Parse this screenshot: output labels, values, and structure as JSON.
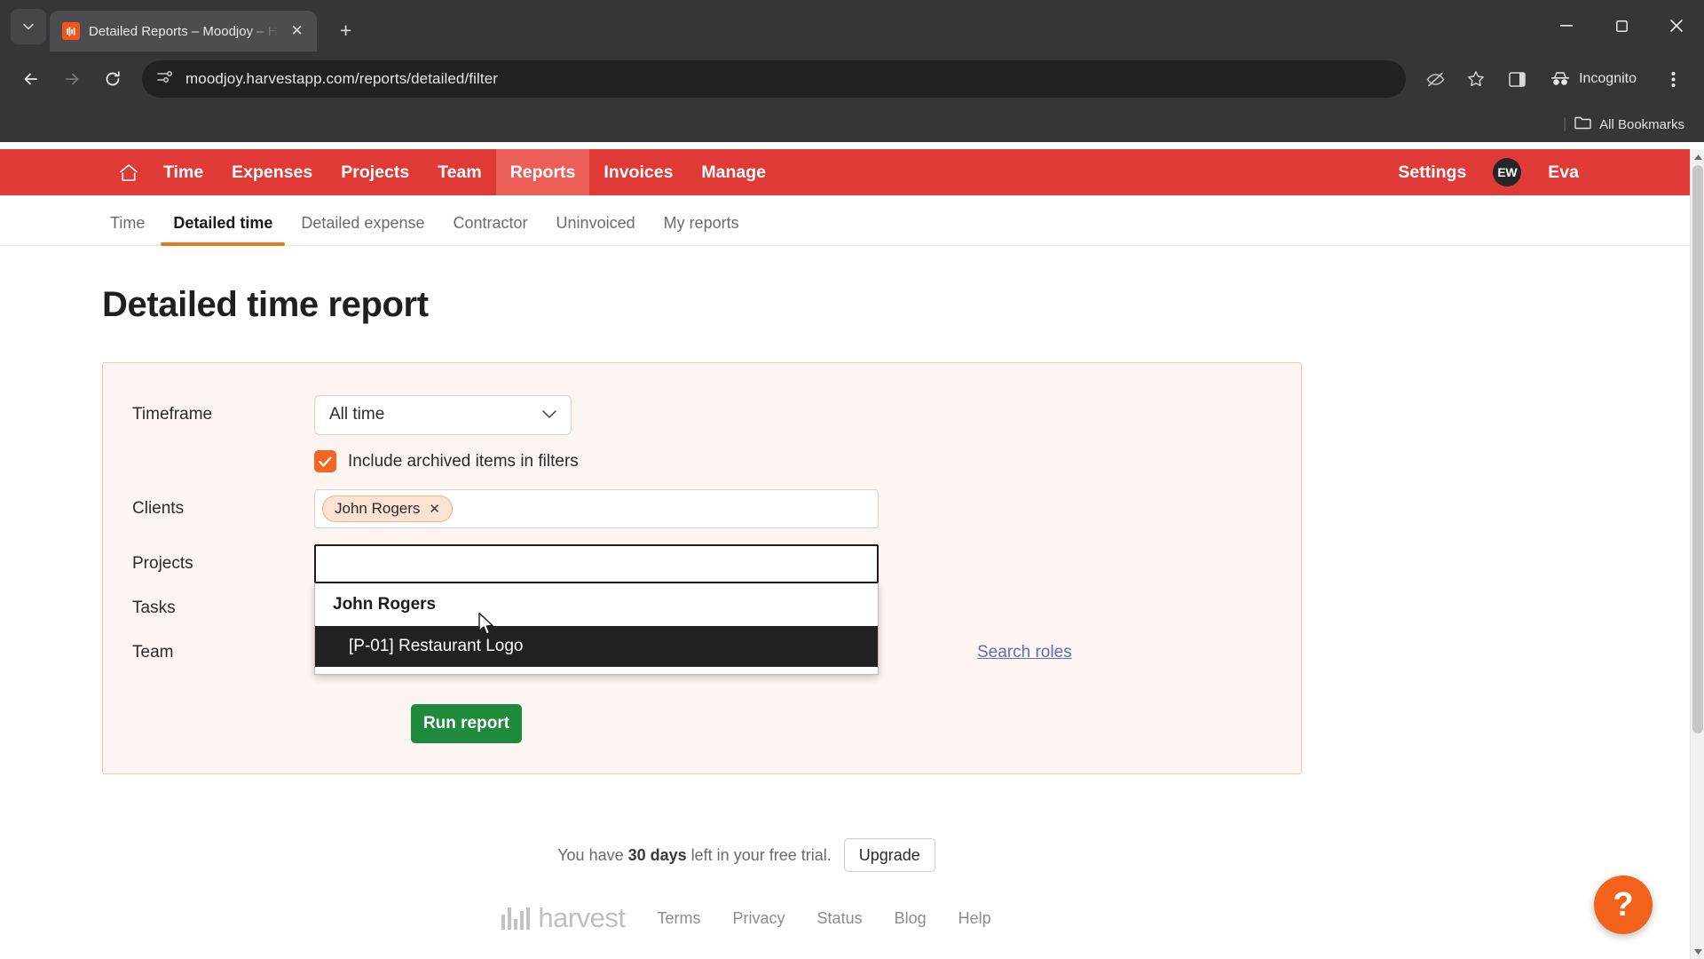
{
  "browser": {
    "tab": {
      "title": "Detailed Reports – Moodjoy – H",
      "favicon": "harvest-favicon",
      "close": "✕"
    },
    "new_tab": "+",
    "window_controls": {
      "minimize": "–",
      "maximize": "▢",
      "close": "✕"
    },
    "nav": {
      "back": "←",
      "forward": "→",
      "reload": "⟳"
    },
    "url": "moodjoy.harvestapp.com/reports/detailed/filter",
    "incognito_label": "Incognito",
    "bookmarks_label": "All Bookmarks"
  },
  "topnav": {
    "home_icon": "home-icon",
    "items": [
      {
        "label": "Time",
        "active": false
      },
      {
        "label": "Expenses",
        "active": false
      },
      {
        "label": "Projects",
        "active": false
      },
      {
        "label": "Team",
        "active": false
      },
      {
        "label": "Reports",
        "active": true
      },
      {
        "label": "Invoices",
        "active": false
      },
      {
        "label": "Manage",
        "active": false
      }
    ],
    "settings_label": "Settings",
    "avatar_initials": "EW",
    "user_name": "Eva",
    "background_color": "#e03a36",
    "active_background_color": "#ec5f59"
  },
  "subnav": {
    "tabs": [
      {
        "label": "Time",
        "active": false
      },
      {
        "label": "Detailed time",
        "active": true
      },
      {
        "label": "Detailed expense",
        "active": false
      },
      {
        "label": "Contractor",
        "active": false
      },
      {
        "label": "Uninvoiced",
        "active": false
      },
      {
        "label": "My reports",
        "active": false
      }
    ],
    "active_underline_color": "#e8761a"
  },
  "page": {
    "title": "Detailed time report"
  },
  "filters": {
    "timeframe": {
      "label": "Timeframe",
      "value": "All time",
      "chevron": "⌄"
    },
    "archived": {
      "label": "Include archived items in filters",
      "checked": true,
      "check_glyph": "✓",
      "color": "#f26522"
    },
    "clients": {
      "label": "Clients",
      "chips": [
        {
          "text": "John Rogers",
          "remove": "✕"
        }
      ]
    },
    "projects": {
      "label": "Projects",
      "value": "",
      "dropdown": {
        "group_header": "John Rogers",
        "options": [
          {
            "label": "[P-01] Restaurant Logo",
            "highlighted": true
          }
        ]
      }
    },
    "tasks": {
      "label": "Tasks"
    },
    "team": {
      "label": "Team",
      "search_roles_link": "Search roles"
    },
    "run_report_button": "Run report",
    "card_background": "#fdf5f1",
    "card_border": "#f3c7a8"
  },
  "trial": {
    "prefix": "You have ",
    "days": "30 days",
    "suffix": " left in your free trial.",
    "upgrade_button": "Upgrade"
  },
  "footer": {
    "logo_text": "harvest",
    "links": [
      "Terms",
      "Privacy",
      "Status",
      "Blog",
      "Help"
    ]
  },
  "help_fab": {
    "glyph": "?",
    "color": "#f2621b"
  }
}
